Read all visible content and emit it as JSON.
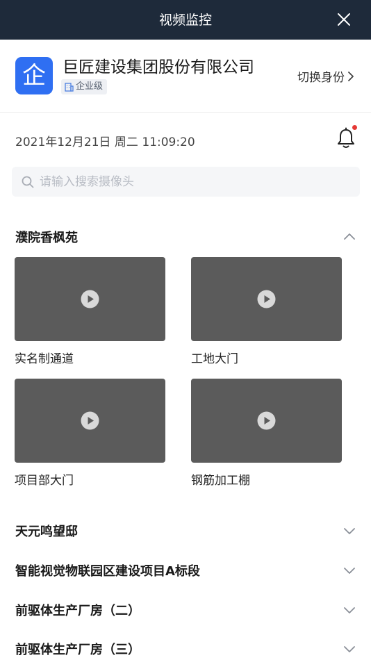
{
  "header": {
    "title": "视频监控",
    "close_icon": "close-icon"
  },
  "company": {
    "logo_text": "企",
    "name": "巨匠建设集团股份有限公司",
    "level": "企业级",
    "switch_label": "切换身份",
    "brand_color": "#2f6ff2"
  },
  "datetime": "2021年12月21日 周二 11:09:20",
  "notification": {
    "icon": "bell-icon",
    "has_unread": true
  },
  "search": {
    "placeholder": "请输入搜索摄像头",
    "value": ""
  },
  "groups": [
    {
      "name": "濮院香枫苑",
      "expanded": true,
      "cameras": [
        {
          "label": "实名制通道"
        },
        {
          "label": "工地大门"
        },
        {
          "label": "项目部大门"
        },
        {
          "label": "钢筋加工棚"
        }
      ]
    },
    {
      "name": "天元鸣望邸",
      "expanded": false
    },
    {
      "name": "智能视觉物联园区建设项目A标段",
      "expanded": false
    },
    {
      "name": "前驱体生产厂房（二）",
      "expanded": false
    },
    {
      "name": "前驱体生产厂房（三）",
      "expanded": false
    }
  ]
}
